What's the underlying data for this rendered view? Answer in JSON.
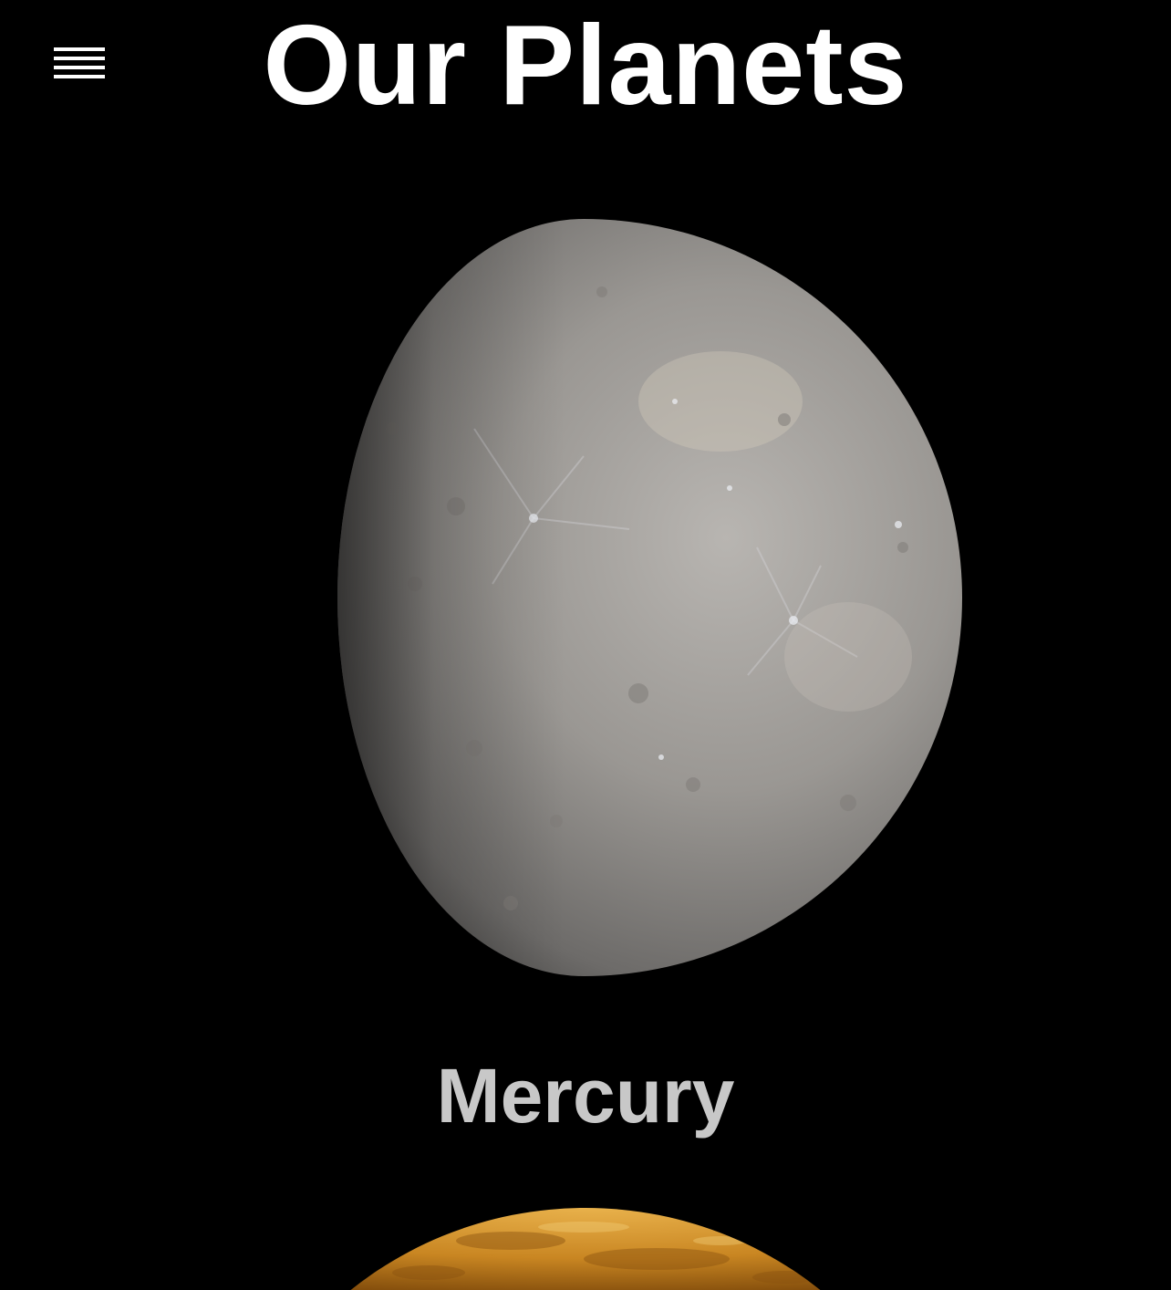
{
  "header": {
    "title": "Our Planets",
    "menu_icon": "hamburger-menu-icon"
  },
  "planets": [
    {
      "name": "Mercury",
      "color": "#8f8d8b",
      "highlight": "#c9c6c2",
      "shadow": "#2a2928"
    },
    {
      "name": "",
      "color": "#c9871f",
      "highlight": "#e6b04a",
      "shadow": "#5a3305"
    }
  ],
  "colors": {
    "background": "#000000",
    "title": "#ffffff",
    "planet_label": "#c8c8c8"
  }
}
